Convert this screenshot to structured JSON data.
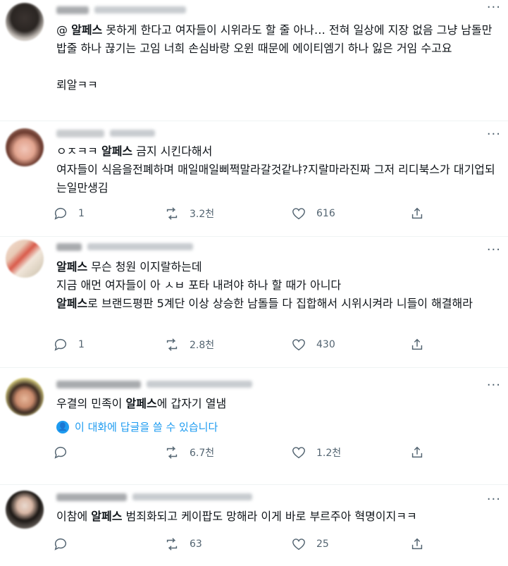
{
  "tweets": [
    {
      "segments": [
        {
          "t": "@ "
        },
        {
          "t": "알페스",
          "b": true
        },
        {
          "t": " 못하게 한다고 여자들이 시위라도 할 줄 아나… 전혀 일상에 지장 없음 그냥 남돌만 밥줄 하나 끊기는 고임 너희 손심바랑 오윈 때문에 에이티엠기 하나 잃은 거임 수고요\n\n뢰알ㅋㅋ"
        }
      ],
      "stats": null,
      "more_icon": "more-horizontal-icon"
    },
    {
      "segments": [
        {
          "t": "ㅇㅈㅋㅋ "
        },
        {
          "t": "알페스",
          "b": true
        },
        {
          "t": " 금지 시킨다해서\n여자들이 식음을전폐하며 매일매일삐쩍말라갈것같냐?지랄마라진짜 그저 리디북스가 대기업되는일만생김"
        }
      ],
      "stats": {
        "replies": "1",
        "retweets": "3.2천",
        "likes": "616"
      }
    },
    {
      "segments": [
        {
          "t": "알페스",
          "b": true
        },
        {
          "t": " 무슨 청원 이지랄하는데\n지금 애먼 여자들이 아 ㅅㅂ 포타 내려야 하나 할 때가 아니다\n"
        },
        {
          "t": "알페스",
          "b": true
        },
        {
          "t": "로 브랜드평판 5계단 이상 상승한 남돌들 다 집합해서 시위시켜라 니들이 해결해라"
        }
      ],
      "stats": {
        "replies": "1",
        "retweets": "2.8천",
        "likes": "430"
      }
    },
    {
      "segments": [
        {
          "t": "우결의 민족이 "
        },
        {
          "t": "알페스",
          "b": true
        },
        {
          "t": "에 갑자기 열냄"
        }
      ],
      "reply_note": "이 대화에 답글을 쓸 수 있습니다",
      "stats": {
        "replies": "",
        "retweets": "6.7천",
        "likes": "1.2천"
      }
    },
    {
      "segments": [
        {
          "t": "이참에 "
        },
        {
          "t": "알페스",
          "b": true
        },
        {
          "t": " 범죄화되고 케이팝도 망해라 이게 바로 부르주아 혁명이지ㅋㅋ"
        }
      ],
      "stats": {
        "replies": "",
        "retweets": "63",
        "likes": "25"
      }
    }
  ],
  "colors": {
    "muted": "#536471",
    "accent": "#1d9bf0",
    "divider": "#eff3f4"
  }
}
